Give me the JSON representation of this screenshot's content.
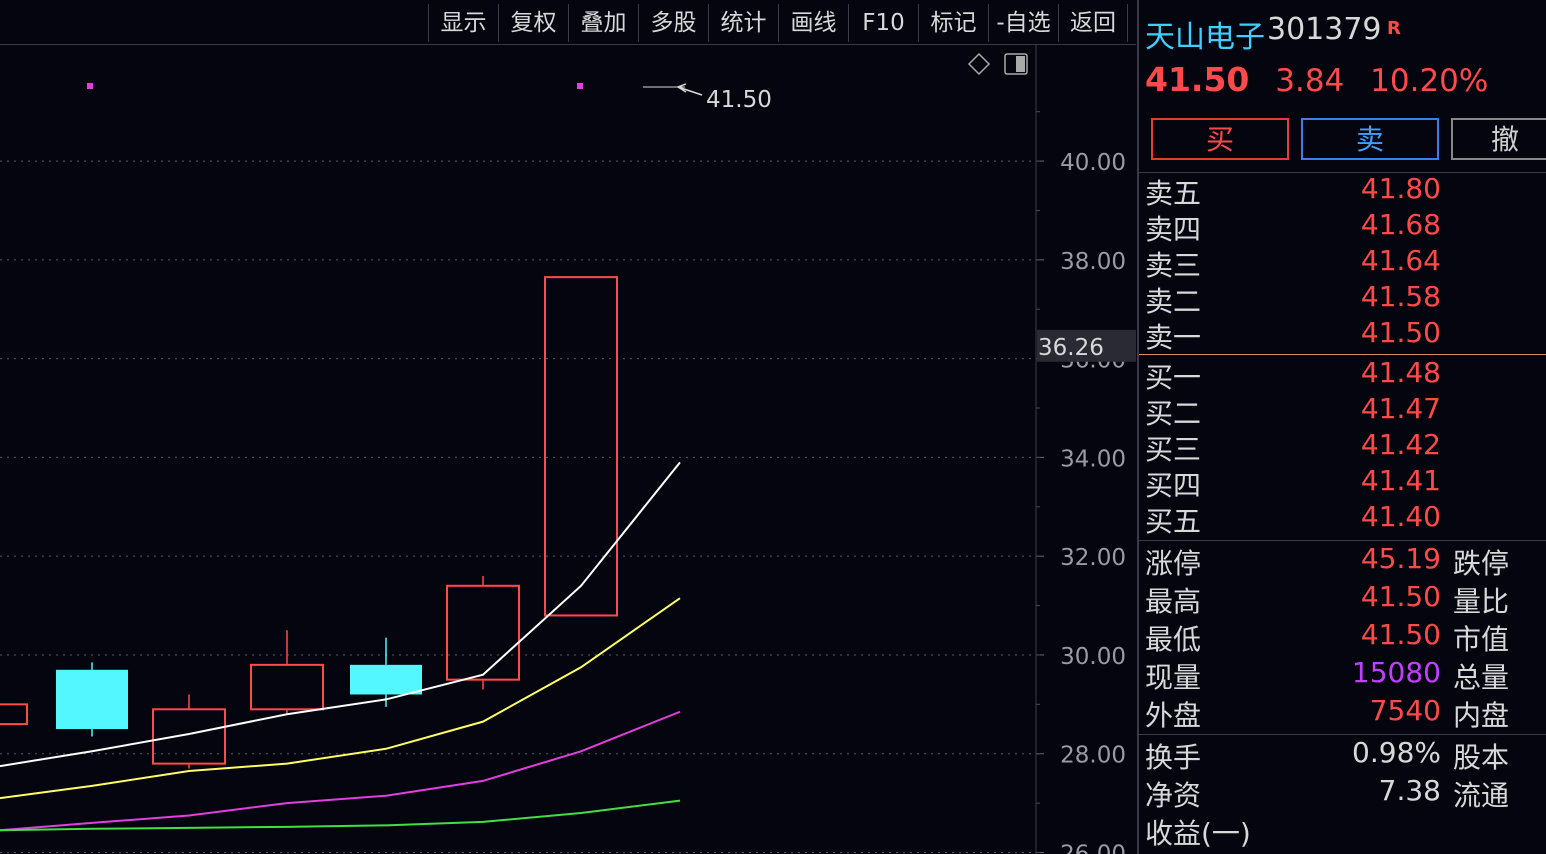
{
  "toolbar": {
    "buttons": [
      "显示",
      "复权",
      "叠加",
      "多股",
      "统计",
      "画线",
      "F10",
      "标记",
      "-自选",
      "返回"
    ]
  },
  "stock": {
    "name": "天山电子",
    "code": "301379",
    "badge": "R",
    "price": "41.50",
    "change": "3.84",
    "change_pct": "10.20%"
  },
  "trade_buttons": {
    "buy": "买",
    "sell": "卖",
    "cancel": "撤"
  },
  "order_book": {
    "asks": [
      {
        "label": "卖五",
        "price": "41.80"
      },
      {
        "label": "卖四",
        "price": "41.68"
      },
      {
        "label": "卖三",
        "price": "41.64"
      },
      {
        "label": "卖二",
        "price": "41.58"
      },
      {
        "label": "卖一",
        "price": "41.50"
      }
    ],
    "bids": [
      {
        "label": "买一",
        "price": "41.48"
      },
      {
        "label": "买二",
        "price": "41.47"
      },
      {
        "label": "买三",
        "price": "41.42"
      },
      {
        "label": "买四",
        "price": "41.41"
      },
      {
        "label": "买五",
        "price": "41.40"
      }
    ]
  },
  "stats": [
    {
      "label": "涨停",
      "value": "45.19",
      "label2": "跌停",
      "color": "red"
    },
    {
      "label": "最高",
      "value": "41.50",
      "label2": "量比",
      "color": "red"
    },
    {
      "label": "最低",
      "value": "41.50",
      "label2": "市值",
      "color": "red"
    },
    {
      "label": "现量",
      "value": "15080",
      "label2": "总量",
      "color": "purple"
    },
    {
      "label": "外盘",
      "value": "7540",
      "label2": "内盘",
      "color": "red"
    }
  ],
  "stats2": [
    {
      "label": "换手",
      "value": "0.98%",
      "label2": "股本",
      "color": "white"
    },
    {
      "label": "净资",
      "value": "7.38",
      "label2": "流通",
      "color": "white"
    },
    {
      "label": "收益(一)",
      "value": "",
      "label2": "",
      "color": "white"
    }
  ],
  "colors": {
    "up": "#ff4a4a",
    "down": "#52f7ff",
    "ma1": "#ffffff",
    "ma2": "#ffff66",
    "ma3": "#e040e0",
    "ma4": "#40e040"
  },
  "chart_data": {
    "type": "candlestick",
    "y_axis_ticks": [
      "40.00",
      "38.00",
      "36.00",
      "34.00",
      "32.00",
      "30.00",
      "28.00",
      "26.00"
    ],
    "ylim": [
      25.97,
      42.35
    ],
    "grid": true,
    "crosshair_price": "36.26",
    "max_price_label": "41.50",
    "candles": [
      {
        "open": 29.0,
        "close": 28.6,
        "high": 29.0,
        "low": 28.6,
        "dir": "up"
      },
      {
        "open": 29.7,
        "close": 28.5,
        "high": 29.85,
        "low": 28.35,
        "dir": "down"
      },
      {
        "open": 27.8,
        "close": 28.9,
        "high": 29.2,
        "low": 27.7,
        "dir": "up"
      },
      {
        "open": 28.9,
        "close": 29.8,
        "high": 30.5,
        "low": 28.8,
        "dir": "up"
      },
      {
        "open": 29.8,
        "close": 29.2,
        "high": 30.35,
        "low": 28.95,
        "dir": "down"
      },
      {
        "open": 29.5,
        "close": 31.4,
        "high": 31.6,
        "low": 29.3,
        "dir": "up"
      },
      {
        "open": 30.8,
        "close": 37.65,
        "high": 37.65,
        "low": 30.8,
        "dir": "up"
      },
      {
        "open": 41.5,
        "close": 41.5,
        "high": 41.5,
        "low": 41.5,
        "dir": "up"
      }
    ],
    "ma_series": [
      {
        "values": [
          27.75,
          28.05,
          28.4,
          28.8,
          29.1,
          29.6,
          31.4,
          33.9
        ]
      },
      {
        "values": [
          27.1,
          27.35,
          27.65,
          27.8,
          28.1,
          28.65,
          29.75,
          31.15
        ]
      },
      {
        "values": [
          26.45,
          26.6,
          26.75,
          27.0,
          27.15,
          27.45,
          28.05,
          28.85
        ]
      },
      {
        "values": [
          26.45,
          26.48,
          26.5,
          26.52,
          26.55,
          26.62,
          26.8,
          27.05
        ]
      }
    ]
  }
}
